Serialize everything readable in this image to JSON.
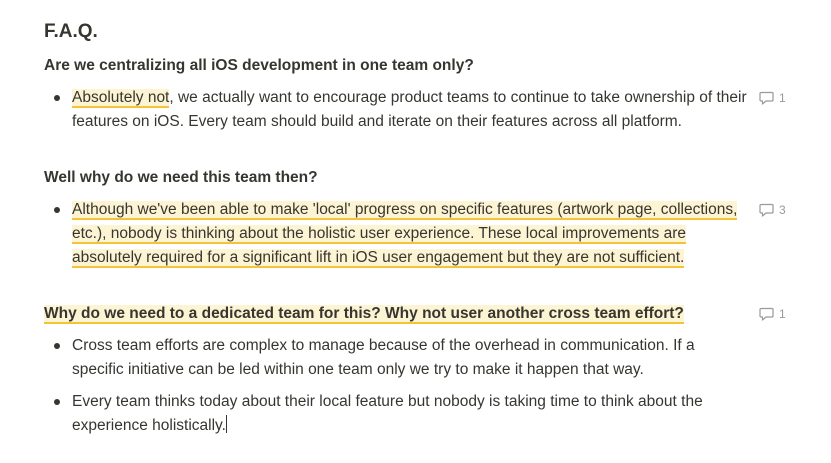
{
  "doc": {
    "title": "F.A.Q."
  },
  "sections": [
    {
      "question": "Are we centralizing all iOS development in one team only?",
      "bullets": [
        {
          "highlight": "Absolutely not",
          "text": ", we actually want to encourage product teams to continue to take ownership of their features on iOS. Every team should build and iterate on their features across all platform.",
          "comment_count": "1"
        }
      ]
    },
    {
      "question": "Well why do we need this team then?",
      "bullets": [
        {
          "highlight": "Although we've been able to make 'local' progress on specific features (artwork page, collections, etc.), nobody is thinking about the holistic user experience. These local improvements are absolutely required for a significant lift in iOS user engagement but they are not sufficient.",
          "comment_count": "3"
        }
      ]
    },
    {
      "question": "Why do we need to a dedicated team for this? Why not user another cross team effort?",
      "comment_count": "1",
      "bullets": [
        {
          "text": "Cross team efforts are complex to manage because of the overhead in communication. If a specific initiative can be led within one team only we try to make it happen that way."
        },
        {
          "text": "Every team thinks today about their local feature but nobody is taking time to think about the experience holistically."
        }
      ]
    }
  ],
  "colors": {
    "text": "#37352f",
    "highlight_bg": "#fdf4d4",
    "highlight_underline": "#f3c33a",
    "muted": "#9b9a97"
  },
  "icons": {
    "comment": "comment-bubble-icon"
  }
}
